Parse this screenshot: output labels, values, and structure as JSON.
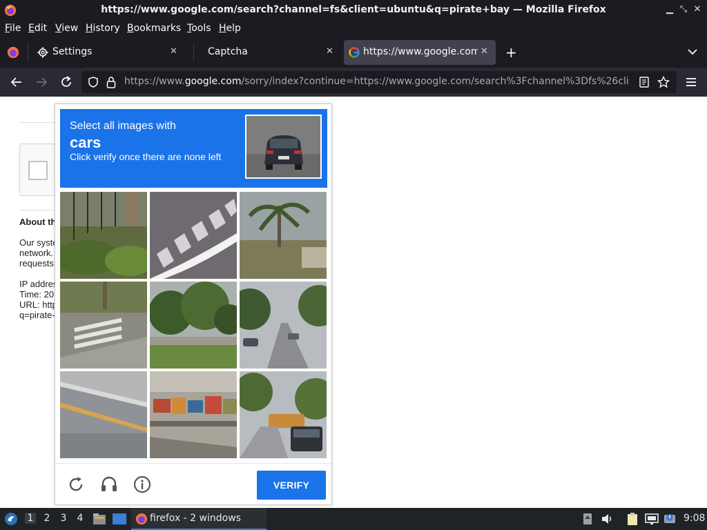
{
  "window": {
    "title": "https://www.google.com/search?channel=fs&client=ubuntu&q=pirate+bay — Mozilla Firefox"
  },
  "menu": [
    "File",
    "Edit",
    "View",
    "History",
    "Bookmarks",
    "Tools",
    "Help"
  ],
  "tabs": [
    {
      "label": "Settings",
      "icon": "gear-icon"
    },
    {
      "label": "Captcha",
      "icon": ""
    },
    {
      "label": "https://www.google.com/",
      "icon": "google-icon",
      "active": true
    }
  ],
  "urlbar": {
    "prefix": "https://www.",
    "domain": "google.com",
    "rest": "/sorry/index?continue=https://www.google.com/search%3Fchannel%3Dfs%26cli"
  },
  "page": {
    "about_heading": "About th",
    "para1": [
      "Our syste",
      "network.",
      "requests"
    ],
    "para2": [
      "IP addres",
      "Time: 20",
      "URL: http",
      "q=pirate-"
    ]
  },
  "captcha": {
    "line1": "Select all images with",
    "target": "cars",
    "line3": "Click verify once there are none left",
    "verify_label": "VERIFY",
    "tiles": [
      "fence-grass",
      "crosswalk-road",
      "palm-tree",
      "crosswalk-curb",
      "trees-park",
      "street-cars",
      "curb-road",
      "market-stalls",
      "street-bus-car"
    ]
  },
  "taskbar": {
    "workspaces": [
      "1",
      "2",
      "3",
      "4"
    ],
    "active_workspace": "1",
    "window_label": "firefox - 2 windows",
    "clock": "9:08"
  },
  "colors": {
    "accent": "#1a73e8",
    "chrome_dark": "#1c1b22"
  }
}
